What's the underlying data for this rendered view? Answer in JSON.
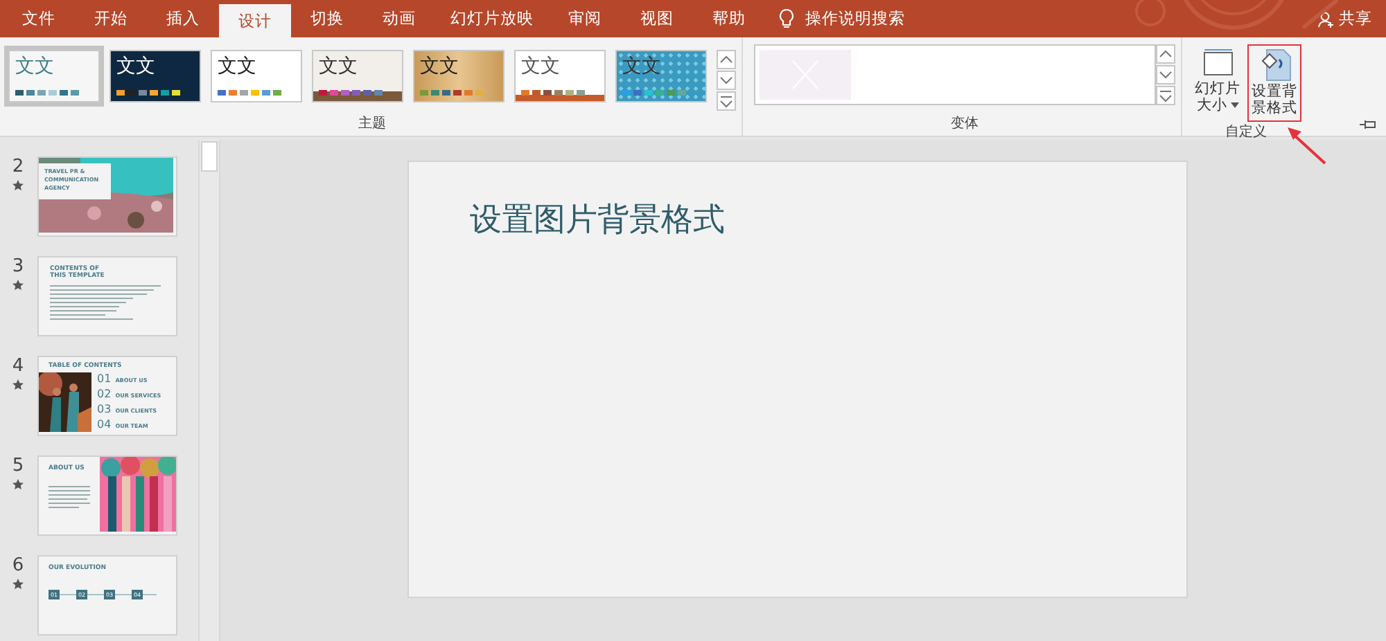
{
  "tabs": [
    {
      "label": "文件",
      "selected": false
    },
    {
      "label": "开始",
      "selected": false
    },
    {
      "label": "插入",
      "selected": false
    },
    {
      "label": "设计",
      "selected": true
    },
    {
      "label": "切换",
      "selected": false
    },
    {
      "label": "动画",
      "selected": false
    },
    {
      "label": "幻灯片放映",
      "selected": false
    },
    {
      "label": "审阅",
      "selected": false
    },
    {
      "label": "视图",
      "selected": false
    },
    {
      "label": "帮助",
      "selected": false
    }
  ],
  "search": {
    "label": "操作说明搜索"
  },
  "share": {
    "label": "共享"
  },
  "themes": {
    "label": "主题",
    "items": [
      {
        "sample": "文文",
        "kind": "office",
        "selected": true
      },
      {
        "sample": "文文",
        "kind": "dark",
        "selected": false
      },
      {
        "sample": "文文",
        "kind": "plain",
        "selected": false
      },
      {
        "sample": "文文",
        "kind": "paper",
        "selected": false
      },
      {
        "sample": "文文",
        "kind": "wood",
        "selected": false
      },
      {
        "sample": "文文",
        "kind": "stripe",
        "selected": false
      },
      {
        "sample": "文文",
        "kind": "pattern",
        "selected": false
      }
    ]
  },
  "variants": {
    "label": "变体"
  },
  "customize": {
    "label": "自定义",
    "buttons": [
      {
        "label": "幻灯片大小",
        "dropdown": true,
        "highlighted": false
      },
      {
        "label": "设置背景格式",
        "dropdown": false,
        "highlighted": true
      }
    ]
  },
  "slides": [
    {
      "number": "2",
      "kind": "cover",
      "title": "TRAVEL PR & COMMUNICATION AGENCY"
    },
    {
      "number": "3",
      "kind": "text",
      "title": "CONTENTS OF THIS TEMPLATE"
    },
    {
      "number": "4",
      "kind": "toc",
      "title": "TABLE OF CONTENTS",
      "items": [
        {
          "num": "01",
          "label": "ABOUT US"
        },
        {
          "num": "02",
          "label": "OUR SERVICES"
        },
        {
          "num": "03",
          "label": "OUR CLIENTS"
        },
        {
          "num": "04",
          "label": "OUR TEAM"
        }
      ]
    },
    {
      "number": "5",
      "kind": "about",
      "title": "ABOUT US"
    },
    {
      "number": "6",
      "kind": "timeline",
      "title": "OUR EVOLUTION",
      "items": [
        {
          "num": "01"
        },
        {
          "num": "02"
        },
        {
          "num": "03"
        },
        {
          "num": "04"
        }
      ]
    }
  ],
  "current_slide": {
    "title": "设置图片背景格式"
  }
}
